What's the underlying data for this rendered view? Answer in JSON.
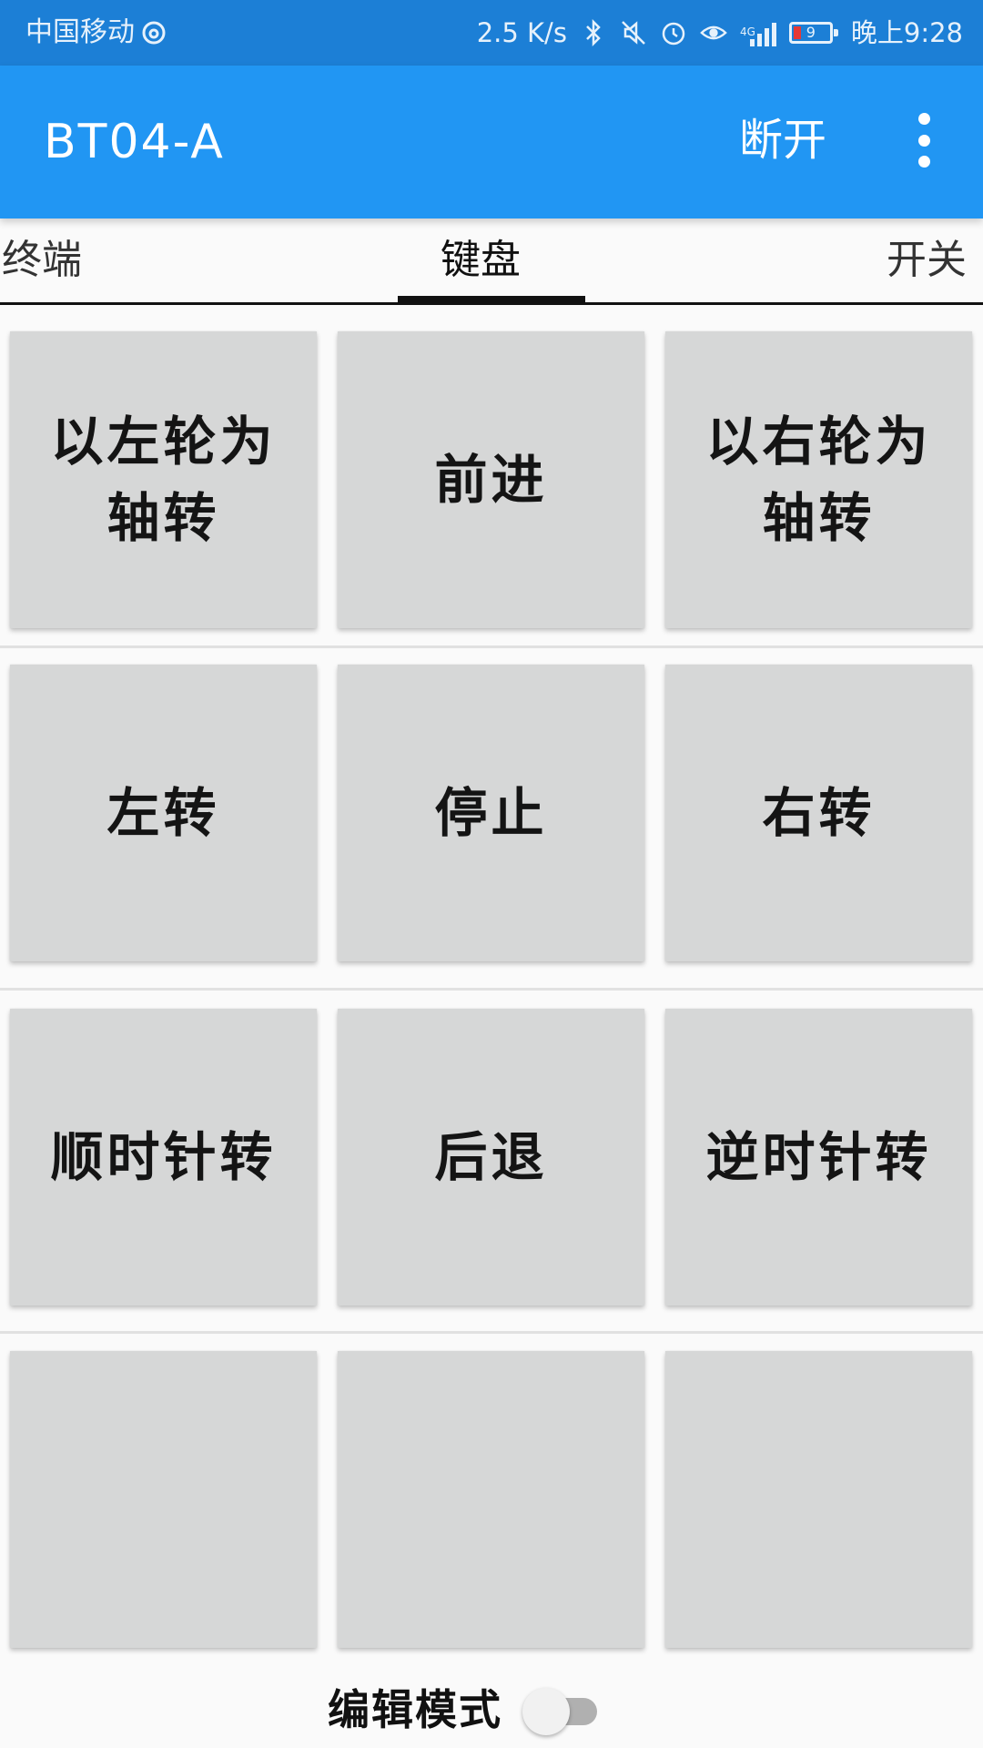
{
  "status_bar": {
    "carrier": "中国移动",
    "carrier_icon": "weibo-icon",
    "net_speed": "2.5 K/s",
    "network_type": "4G",
    "battery_level": "9",
    "time": "晚上9:28",
    "icons": [
      "bluetooth-icon",
      "mute-icon",
      "alarm-icon",
      "eye-comfort-icon",
      "signal-icon",
      "battery-icon"
    ]
  },
  "app_bar": {
    "title": "BT04-A",
    "disconnect_label": "断开",
    "menu_icon": "more-vert-icon"
  },
  "tabs": [
    {
      "label": "终端"
    },
    {
      "label": "键盘",
      "selected": true
    },
    {
      "label": "开关"
    }
  ],
  "keypad": {
    "rows": [
      [
        "以左轮为轴转",
        "前进",
        "以右轮为轴转"
      ],
      [
        "左转",
        "停止",
        "右转"
      ],
      [
        "顺时针转",
        "后退",
        "逆时针转"
      ],
      [
        "",
        "",
        ""
      ]
    ]
  },
  "edit_mode": {
    "label": "编辑模式",
    "enabled": false
  },
  "colors": {
    "status_bar": "#1c7fd6",
    "app_bar": "#2196f3",
    "key_background": "#d6d7d7",
    "tab_indicator": "#111111"
  }
}
